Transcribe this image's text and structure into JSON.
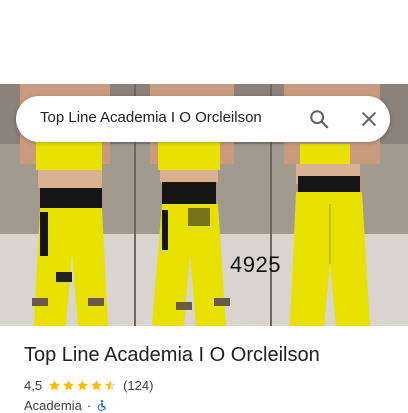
{
  "search": {
    "query": "Top Line Academia I O Orcleilson"
  },
  "icons": {
    "search": "search-icon",
    "close": "close-icon",
    "accessibility": "accessibility-icon"
  },
  "photo": {
    "watermark": "4925"
  },
  "place": {
    "title": "Top Line Academia I O Orcleilson",
    "rating": "4,5",
    "stars": 4.5,
    "reviews": "(124)",
    "category": "Academia",
    "separator": "·"
  },
  "colors": {
    "star": "#fbbc04",
    "legging": "#e8e100",
    "text": "#202124",
    "accessibility": "#1a73e8"
  }
}
